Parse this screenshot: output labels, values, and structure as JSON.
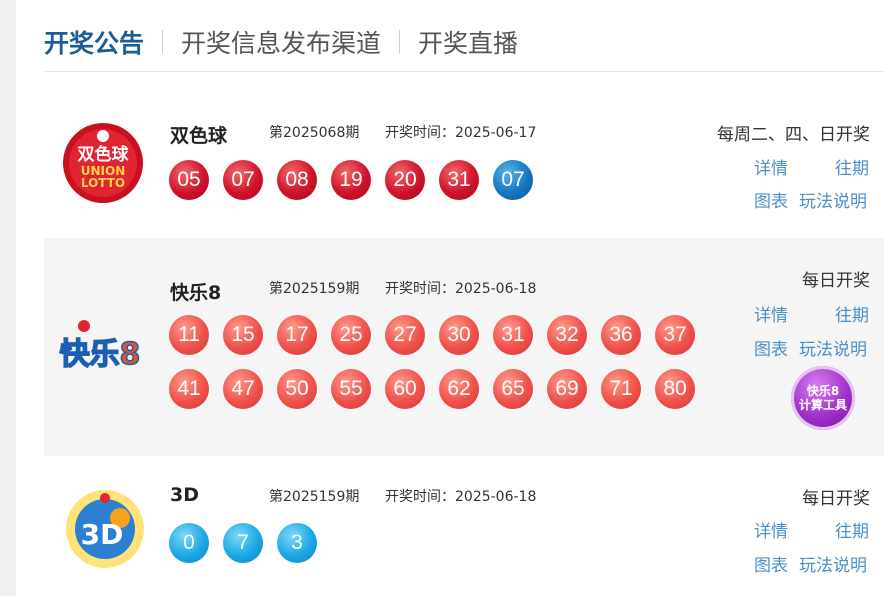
{
  "tabs": [
    "开奖公告",
    "开奖信息发布渠道",
    "开奖直播"
  ],
  "links": {
    "detail": "详情",
    "history": "往期",
    "chart": "图表",
    "rules": "玩法说明"
  },
  "time_label": "开奖时间：",
  "ssq": {
    "name": "双色球",
    "logo_text": "双色球",
    "logo_sub1": "UNION",
    "logo_sub2": "LOTTO",
    "issue": "第2025068期",
    "date": "2025-06-17",
    "schedule": "每周二、四、日开奖",
    "red": [
      "05",
      "07",
      "08",
      "19",
      "20",
      "31"
    ],
    "blue": [
      "07"
    ],
    "colors": {
      "red": "#d0122a",
      "blue": "#1477c0"
    }
  },
  "kl8": {
    "name": "快乐8",
    "logo_text": "快乐8",
    "issue": "第2025159期",
    "date": "2025-06-18",
    "schedule": "每日开奖",
    "numbers": [
      "11",
      "15",
      "17",
      "25",
      "27",
      "30",
      "31",
      "32",
      "36",
      "37",
      "41",
      "47",
      "50",
      "55",
      "60",
      "62",
      "65",
      "69",
      "71",
      "80"
    ],
    "calc_line1": "快乐8",
    "calc_line2": "计算工具",
    "colors": {
      "ball": "#f0504a",
      "calc": "#9d2ec9"
    }
  },
  "fc3d": {
    "name": "3D",
    "logo_text": "3D",
    "issue": "第2025159期",
    "date": "2025-06-18",
    "schedule": "每日开奖",
    "numbers": [
      "0",
      "7",
      "3"
    ],
    "colors": {
      "ball": "#1aa8e4"
    }
  },
  "colors": {
    "active_tab": "#1d5d96",
    "link": "#4a90c8",
    "shade": "#f5f5f5"
  }
}
